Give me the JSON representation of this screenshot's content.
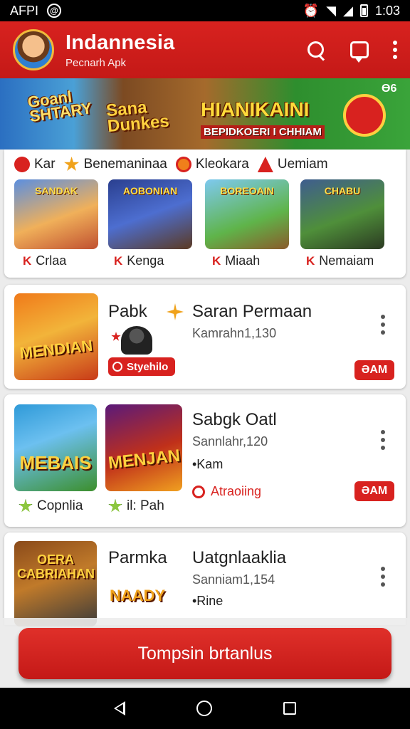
{
  "status_bar": {
    "left_text": "AFPI",
    "circle_icon_text": "@",
    "time": "1:03"
  },
  "app_bar": {
    "title": "Indannesia",
    "subtitle": "Pecnarh Apk"
  },
  "banner": {
    "label_1": "Goanl SHTARY",
    "label_2": "Sana Dunkes",
    "label_3": "HIANIKAINI",
    "label_4": "BEPIDKOERI I CHHIAM",
    "corner_text": "Ɵ6"
  },
  "categories": {
    "chips": [
      "Kar",
      "Benemaninaa",
      "Kleokara",
      "Uemiam"
    ],
    "tiles": [
      {
        "title": "SANDAK",
        "label": "Crlaa",
        "mark": "K"
      },
      {
        "title": "AOBONIAN",
        "label": "Kenga",
        "mark": "K"
      },
      {
        "title": "BOREOAIN",
        "label": "Miaah",
        "mark": "K"
      },
      {
        "title": "CHABU",
        "label": "Nemaiam",
        "mark": "K"
      }
    ]
  },
  "list": [
    {
      "thumb_text": "MENDIAN",
      "name": "Pabk",
      "name_2": "Saran Permaan",
      "meta": "Kamrahn1,130",
      "pill": "Styehilo",
      "action": "ƏAM"
    },
    {
      "thumb_text": "MEBAIS",
      "thumb_text_2": "MENJAN",
      "name": "Sabgk Oatl",
      "meta": "Sannlahr,120",
      "sub": "•Kam",
      "tag_1": "Copnlia",
      "tag_2": "il: Pah",
      "status": "Atraoiing",
      "action": "ƏAM"
    },
    {
      "thumb_text": "OERA CABRIAHAN",
      "name": "Parmka",
      "name_2": "Uatgnlaaklia",
      "logo_text": "NAADY",
      "meta": "Sanniam1,154",
      "sub": "•Rine"
    }
  ],
  "cta": {
    "label": "Tompsin brtanlus"
  },
  "colors": {
    "primary": "#d8221f",
    "background": "#ececec"
  }
}
